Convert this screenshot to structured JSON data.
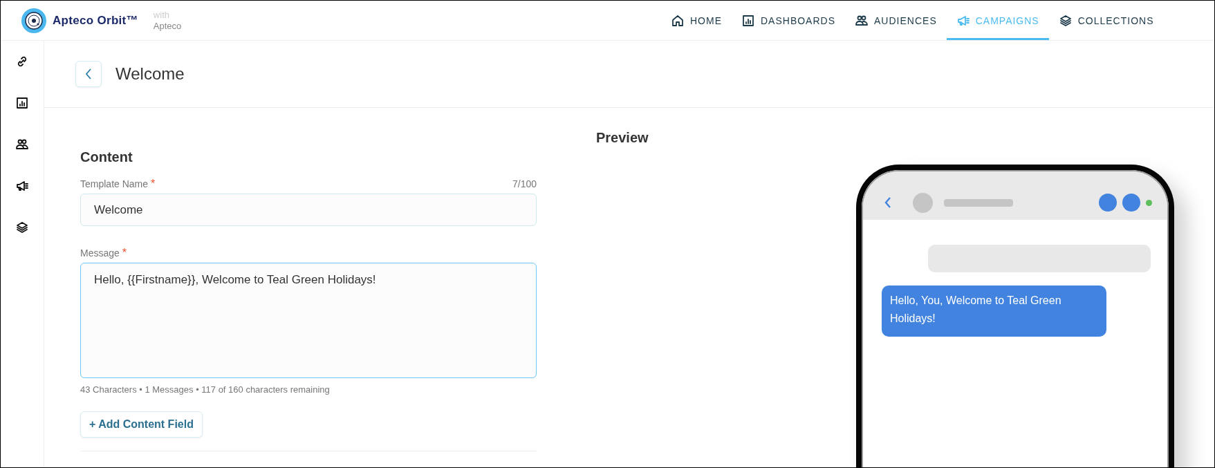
{
  "brand": {
    "name": "Apteco Orbit™",
    "with_label": "with",
    "partner": "Apteco"
  },
  "nav": [
    {
      "label": "HOME",
      "selected": false
    },
    {
      "label": "DASHBOARDS",
      "selected": false
    },
    {
      "label": "AUDIENCES",
      "selected": false
    },
    {
      "label": "CAMPAIGNS",
      "selected": true
    },
    {
      "label": "COLLECTIONS",
      "selected": false
    }
  ],
  "page": {
    "title": "Welcome"
  },
  "content": {
    "heading": "Content",
    "template_name": {
      "label": "Template Name",
      "required_mark": "*",
      "counter": "7/100",
      "value": "Welcome"
    },
    "message": {
      "label": "Message",
      "required_mark": "*",
      "value": "Hello, {{Firstname}}, Welcome to Teal Green Holidays!",
      "focused": true
    },
    "stats": "43 Characters • 1 Messages • 117 of 160 characters remaining",
    "add_button": "+ Add Content Field"
  },
  "preview": {
    "heading": "Preview",
    "message": "Hello, You, Welcome to Teal Green Holidays!"
  }
}
